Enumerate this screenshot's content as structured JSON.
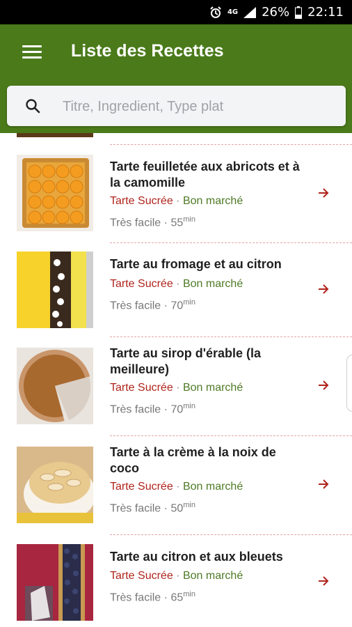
{
  "status_bar": {
    "battery": "26%",
    "time": "22:11",
    "network": "4G"
  },
  "header": {
    "title": "Liste des Recettes"
  },
  "search": {
    "placeholder": "Titre, Ingredient, Type plat",
    "value": ""
  },
  "colors": {
    "appbar": "#4a7a1a",
    "category": "#b0231c",
    "price": "#4d7a25",
    "arrow": "#b0231c"
  },
  "recipes": [
    {
      "title": "Tarte feuilletée aux abricots et à la camomille",
      "category": "Tarte Sucrée",
      "separator": "·",
      "price": "Bon marché",
      "difficulty": "Très facile",
      "time": "55",
      "unit": "min"
    },
    {
      "title": "Tarte au fromage et au citron",
      "category": "Tarte Sucrée",
      "separator": "·",
      "price": "Bon marché",
      "difficulty": "Très facile",
      "time": "70",
      "unit": "min"
    },
    {
      "title": "Tarte au sirop d'érable (la meilleure)",
      "category": "Tarte Sucrée",
      "separator": "·",
      "price": "Bon marché",
      "difficulty": "Très facile",
      "time": "70",
      "unit": "min"
    },
    {
      "title": "Tarte à la crème à la noix de coco",
      "category": "Tarte Sucrée",
      "separator": "·",
      "price": "Bon marché",
      "difficulty": "Très facile",
      "time": "50",
      "unit": "min"
    },
    {
      "title": "Tarte au citron et aux bleuets",
      "category": "Tarte Sucrée",
      "separator": "·",
      "price": "Bon marché",
      "difficulty": "Très facile",
      "time": "65",
      "unit": "min"
    }
  ]
}
